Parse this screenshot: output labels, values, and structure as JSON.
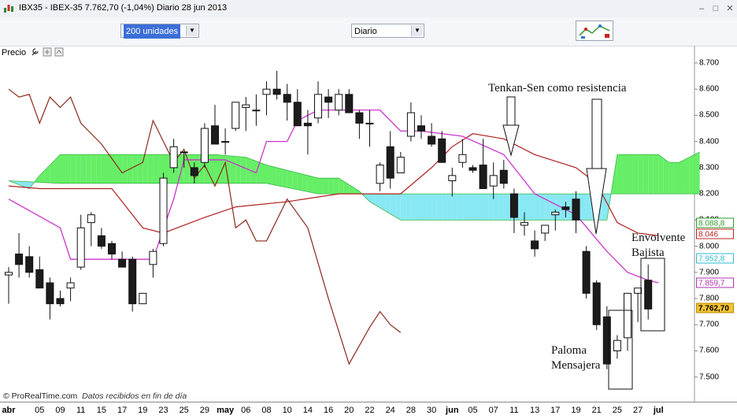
{
  "window": {
    "title": "IBX35 - IBEX-35   7.762,70 (-1,04%)   Diario  28 jun 2013",
    "buttons": [
      "minimize",
      "maximize",
      "close"
    ]
  },
  "toolbar": {
    "units_select": "200 unidades",
    "period_select": "Diario"
  },
  "panel": {
    "label": "Precio"
  },
  "footer": {
    "brand": "© ProRealTime.com",
    "note": "Datos recibidos en fin de día"
  },
  "annotations": {
    "tenkan": "Tenkan-Sen como resistencia",
    "envolvente_1": "Envolvente",
    "envolvente_2": "Bajista",
    "paloma_1": "Paloma",
    "paloma_2": "Mensajera"
  },
  "colors": {
    "bull": "#ffffff",
    "bear": "#1c1c1c",
    "tenkan": "#cc33cc",
    "kijun": "#b02020",
    "chikou": "#8b2a1a",
    "kumo_bull": "#66ee66",
    "kumo_bear": "#88e8f4"
  },
  "chart_data": {
    "type": "candlestick",
    "ylim": [
      7.46,
      8.73
    ],
    "y_ticks": [
      "8.700",
      "8.600",
      "8.500",
      "8.400",
      "8.300",
      "8.200",
      "8.100",
      "8.000",
      "7.900",
      "7.800",
      "7.700",
      "7.600",
      "7.500"
    ],
    "y_badges": [
      {
        "label": "8.088,8",
        "value": 8.0888,
        "color": "#2a9a2a",
        "border": "#2a9a2a"
      },
      {
        "label": "8.046",
        "value": 8.046,
        "color": "#c02020",
        "border": "#c02020"
      },
      {
        "label": "7.952,8",
        "value": 7.9528,
        "color": "#2fb8d0",
        "border": "#2fb8d0"
      },
      {
        "label": "7.859,7",
        "value": 7.8597,
        "color": "#b030b0",
        "border": "#b030b0"
      },
      {
        "label": "7.762,70",
        "value": 7.7627,
        "color": "#000000",
        "border": "#b88a00",
        "bg": "#f4c432"
      }
    ],
    "x_labels": [
      {
        "label": "abr",
        "i": 0,
        "bold": true
      },
      {
        "label": "05",
        "i": 3
      },
      {
        "label": "09",
        "i": 5
      },
      {
        "label": "11",
        "i": 7
      },
      {
        "label": "15",
        "i": 9
      },
      {
        "label": "17",
        "i": 11
      },
      {
        "label": "19",
        "i": 13
      },
      {
        "label": "23",
        "i": 15
      },
      {
        "label": "25",
        "i": 17
      },
      {
        "label": "29",
        "i": 19
      },
      {
        "label": "may",
        "i": 21,
        "bold": true
      },
      {
        "label": "06",
        "i": 23
      },
      {
        "label": "08",
        "i": 25
      },
      {
        "label": "10",
        "i": 27
      },
      {
        "label": "14",
        "i": 29
      },
      {
        "label": "16",
        "i": 31
      },
      {
        "label": "20",
        "i": 33
      },
      {
        "label": "22",
        "i": 35
      },
      {
        "label": "24",
        "i": 37
      },
      {
        "label": "28",
        "i": 39
      },
      {
        "label": "30",
        "i": 41
      },
      {
        "label": "jun",
        "i": 43,
        "bold": true
      },
      {
        "label": "05",
        "i": 45
      },
      {
        "label": "07",
        "i": 47
      },
      {
        "label": "11",
        "i": 49
      },
      {
        "label": "13",
        "i": 51
      },
      {
        "label": "17",
        "i": 53
      },
      {
        "label": "19",
        "i": 55
      },
      {
        "label": "21",
        "i": 57
      },
      {
        "label": "25",
        "i": 59
      },
      {
        "label": "27",
        "i": 61
      },
      {
        "label": "jul",
        "i": 63,
        "bold": true
      }
    ],
    "candles": [
      [
        7.89,
        7.92,
        7.78,
        7.9
      ],
      [
        7.97,
        8.05,
        7.88,
        7.93
      ],
      [
        7.96,
        8.0,
        7.88,
        7.9
      ],
      [
        7.91,
        7.96,
        7.84,
        7.84
      ],
      [
        7.86,
        7.88,
        7.72,
        7.78
      ],
      [
        7.8,
        7.83,
        7.77,
        7.78
      ],
      [
        7.84,
        7.88,
        7.79,
        7.86
      ],
      [
        7.92,
        8.12,
        7.91,
        8.07
      ],
      [
        8.09,
        8.13,
        8.0,
        8.12
      ],
      [
        8.04,
        8.07,
        7.99,
        8.0
      ],
      [
        8.01,
        8.02,
        7.95,
        7.97
      ],
      [
        7.95,
        7.98,
        7.93,
        7.92
      ],
      [
        7.95,
        7.96,
        7.75,
        7.78
      ],
      [
        7.78,
        7.81,
        7.78,
        7.82
      ],
      [
        7.93,
        7.99,
        7.88,
        7.98
      ],
      [
        8.01,
        8.28,
        8.0,
        8.26
      ],
      [
        8.3,
        8.41,
        8.28,
        8.38
      ],
      [
        8.36,
        8.36,
        8.3,
        8.36
      ],
      [
        8.3,
        8.32,
        8.24,
        8.27
      ],
      [
        8.32,
        8.47,
        8.3,
        8.45
      ],
      [
        8.46,
        8.54,
        8.44,
        8.39
      ],
      [
        8.4,
        8.45,
        8.35,
        8.4
      ],
      [
        8.45,
        8.54,
        8.44,
        8.55
      ],
      [
        8.53,
        8.57,
        8.44,
        8.54
      ],
      [
        8.52,
        8.58,
        8.46,
        8.52
      ],
      [
        8.58,
        8.63,
        8.5,
        8.6
      ],
      [
        8.6,
        8.67,
        8.56,
        8.58
      ],
      [
        8.58,
        8.62,
        8.48,
        8.55
      ],
      [
        8.55,
        8.6,
        8.49,
        8.46
      ],
      [
        8.47,
        8.52,
        8.35,
        8.46
      ],
      [
        8.49,
        8.63,
        8.47,
        8.58
      ],
      [
        8.57,
        8.6,
        8.49,
        8.55
      ],
      [
        8.52,
        8.6,
        8.5,
        8.58
      ],
      [
        8.58,
        8.6,
        8.51,
        8.51
      ],
      [
        8.51,
        8.52,
        8.41,
        8.47
      ],
      [
        8.47,
        8.52,
        8.38,
        8.47
      ],
      [
        8.24,
        8.32,
        8.21,
        8.31
      ],
      [
        8.38,
        8.44,
        8.22,
        8.26
      ],
      [
        8.28,
        8.36,
        8.28,
        8.34
      ],
      [
        8.42,
        8.55,
        8.4,
        8.51
      ],
      [
        8.46,
        8.5,
        8.41,
        8.44
      ],
      [
        8.42,
        8.47,
        8.38,
        8.39
      ],
      [
        8.41,
        8.44,
        8.38,
        8.32
      ],
      [
        8.25,
        8.3,
        8.19,
        8.27
      ],
      [
        8.32,
        8.41,
        8.3,
        8.35
      ],
      [
        8.3,
        8.31,
        8.28,
        8.29
      ],
      [
        8.31,
        8.41,
        8.22,
        8.22
      ],
      [
        8.23,
        8.32,
        8.18,
        8.27
      ],
      [
        8.29,
        8.33,
        8.22,
        8.24
      ],
      [
        8.2,
        8.22,
        8.05,
        8.11
      ],
      [
        8.08,
        8.13,
        8.04,
        8.09
      ],
      [
        8.02,
        8.06,
        7.96,
        7.99
      ],
      [
        8.05,
        8.07,
        8.02,
        8.08
      ],
      [
        8.12,
        8.14,
        8.06,
        8.13
      ],
      [
        8.15,
        8.17,
        8.11,
        8.14
      ],
      [
        8.18,
        8.21,
        8.05,
        8.1
      ],
      [
        7.98,
        8.0,
        7.8,
        7.82
      ],
      [
        7.86,
        7.87,
        7.68,
        7.7
      ],
      [
        7.73,
        7.77,
        7.53,
        7.55
      ],
      [
        7.6,
        7.66,
        7.57,
        7.64
      ],
      [
        7.65,
        7.78,
        7.6,
        7.82
      ],
      [
        7.82,
        7.84,
        7.71,
        7.84
      ],
      [
        7.87,
        7.93,
        7.72,
        7.76
      ]
    ],
    "tenkan": [
      [
        0,
        8.18
      ],
      [
        5,
        8.07
      ],
      [
        6,
        7.95
      ],
      [
        12,
        7.95
      ],
      [
        14,
        7.95
      ],
      [
        16,
        8.18
      ],
      [
        17,
        8.33
      ],
      [
        19,
        8.33
      ],
      [
        21,
        8.33
      ],
      [
        24,
        8.28
      ],
      [
        25,
        8.4
      ],
      [
        27,
        8.4
      ],
      [
        28,
        8.48
      ],
      [
        30,
        8.52
      ],
      [
        36,
        8.52
      ],
      [
        38,
        8.44
      ],
      [
        40,
        8.44
      ],
      [
        44,
        8.42
      ],
      [
        48,
        8.35
      ],
      [
        51,
        8.2
      ],
      [
        55,
        8.12
      ],
      [
        58,
        7.98
      ],
      [
        60,
        7.9
      ],
      [
        62,
        7.87
      ],
      [
        63,
        7.86
      ]
    ],
    "kijun": [
      [
        0,
        8.23
      ],
      [
        3,
        8.22
      ],
      [
        10,
        8.22
      ],
      [
        13,
        8.07
      ],
      [
        15,
        8.05
      ],
      [
        19,
        8.11
      ],
      [
        22,
        8.15
      ],
      [
        27,
        8.17
      ],
      [
        32,
        8.2
      ],
      [
        38,
        8.2
      ],
      [
        41,
        8.3
      ],
      [
        43,
        8.38
      ],
      [
        45,
        8.43
      ],
      [
        48,
        8.41
      ],
      [
        51,
        8.35
      ],
      [
        55,
        8.3
      ],
      [
        57,
        8.24
      ],
      [
        59,
        8.09
      ],
      [
        61,
        8.05
      ],
      [
        63,
        8.04
      ]
    ],
    "chikou": [
      [
        0,
        8.6
      ],
      [
        1,
        8.57
      ],
      [
        2,
        8.58
      ],
      [
        3,
        8.47
      ],
      [
        4,
        8.57
      ],
      [
        5,
        8.53
      ],
      [
        6,
        8.57
      ],
      [
        7,
        8.47
      ],
      [
        9,
        8.39
      ],
      [
        11,
        8.28
      ],
      [
        13,
        8.32
      ],
      [
        14,
        8.48
      ],
      [
        15,
        8.4
      ],
      [
        16,
        8.32
      ],
      [
        17,
        8.37
      ],
      [
        18,
        8.26
      ],
      [
        19,
        8.31
      ],
      [
        20,
        8.23
      ],
      [
        21,
        8.32
      ],
      [
        22,
        8.07
      ],
      [
        23,
        8.1
      ],
      [
        24,
        8.02
      ],
      [
        25,
        8.02
      ],
      [
        27,
        8.18
      ],
      [
        29,
        8.07
      ],
      [
        31,
        7.8
      ],
      [
        33,
        7.55
      ],
      [
        35,
        7.69
      ],
      [
        36,
        7.75
      ],
      [
        37,
        7.7
      ],
      [
        38,
        7.67
      ]
    ],
    "senkou_a": [
      [
        0,
        8.25
      ],
      [
        2,
        8.22
      ],
      [
        3,
        8.27
      ],
      [
        5,
        8.35
      ],
      [
        10,
        8.35
      ],
      [
        14,
        8.35
      ],
      [
        16,
        8.35
      ],
      [
        20,
        8.35
      ],
      [
        23,
        8.34
      ],
      [
        25,
        8.31
      ],
      [
        28,
        8.28
      ],
      [
        30,
        8.26
      ],
      [
        32,
        8.26
      ],
      [
        34,
        8.21
      ],
      [
        35,
        8.17
      ],
      [
        38,
        8.1
      ],
      [
        41,
        8.1
      ],
      [
        50,
        8.1
      ],
      [
        52,
        8.1
      ],
      [
        58,
        8.1
      ],
      [
        59,
        8.35
      ],
      [
        63,
        8.35
      ],
      [
        64,
        8.32
      ],
      [
        65,
        8.32
      ],
      [
        67,
        8.36
      ]
    ],
    "senkou_b": [
      [
        0,
        8.25
      ],
      [
        5,
        8.24
      ],
      [
        10,
        8.24
      ],
      [
        15,
        8.24
      ],
      [
        20,
        8.24
      ],
      [
        25,
        8.24
      ],
      [
        30,
        8.2
      ],
      [
        35,
        8.2
      ],
      [
        40,
        8.2
      ],
      [
        45,
        8.2
      ],
      [
        50,
        8.2
      ],
      [
        55,
        8.2
      ],
      [
        60,
        8.2
      ],
      [
        67,
        8.2
      ]
    ]
  }
}
